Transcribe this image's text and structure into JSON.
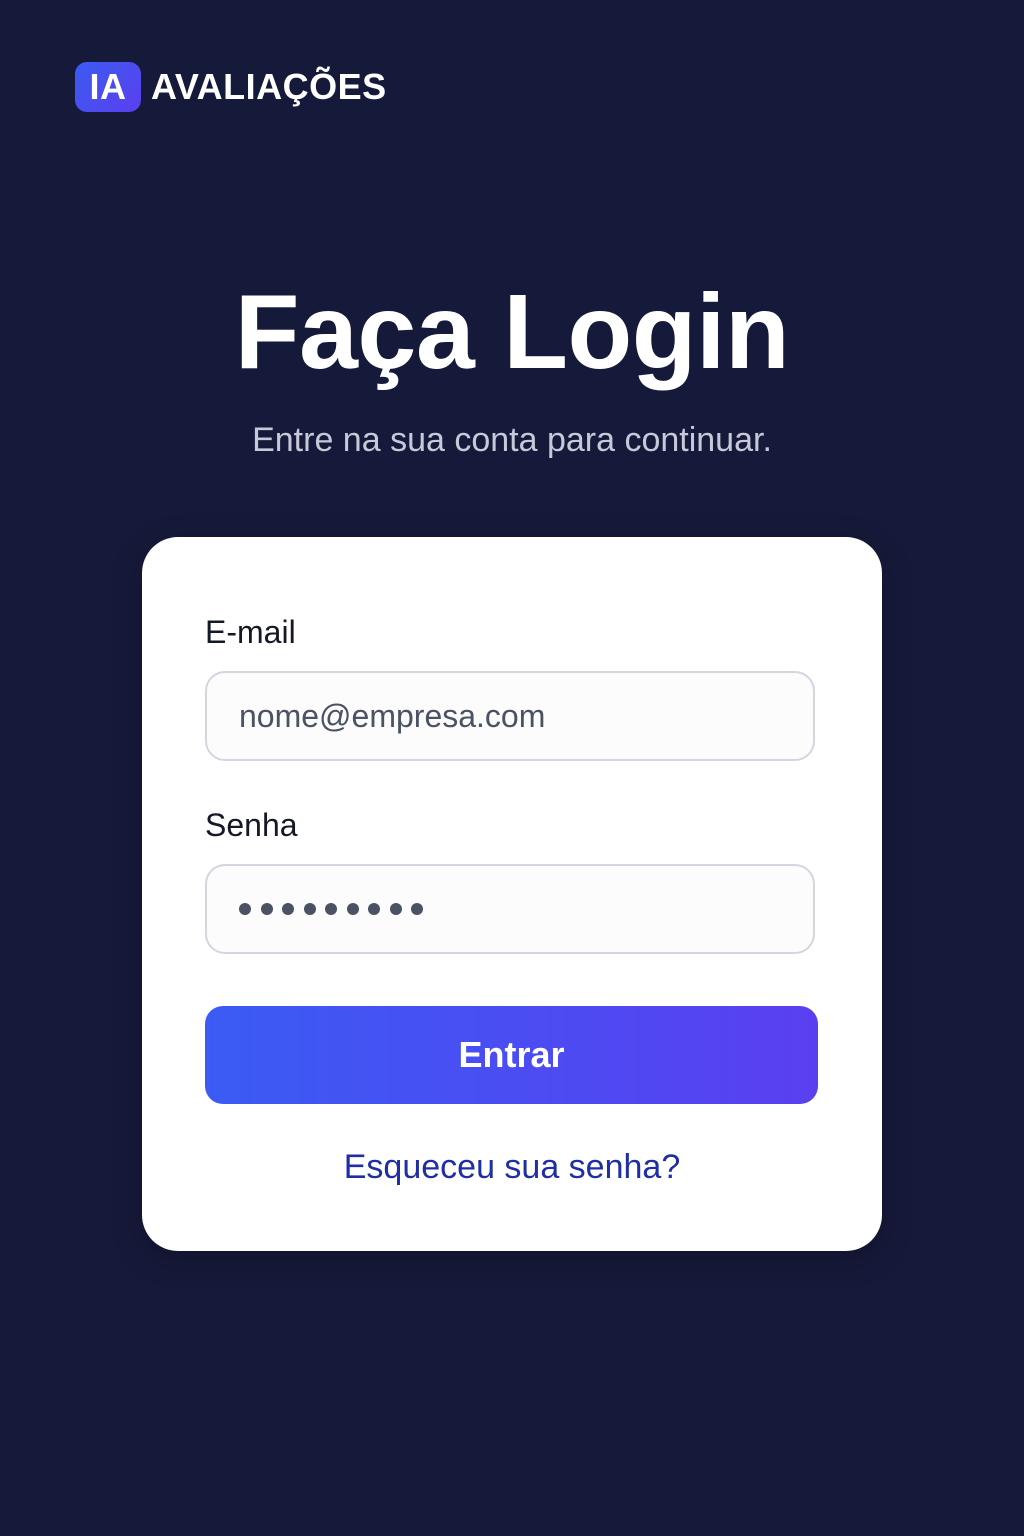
{
  "brand": {
    "badge": "IA",
    "name": "AVALIAÇÕES"
  },
  "header": {
    "title": "Faça Login",
    "subtitle": "Entre na sua conta para continuar."
  },
  "form": {
    "email_label": "E-mail",
    "email_value": "nome@empresa.com",
    "password_label": "Senha",
    "password_masked_length": 9,
    "submit_label": "Entrar",
    "forgot_label": "Esqueceu sua senha?"
  },
  "colors": {
    "background": "#161a3a",
    "card": "#ffffff",
    "accent_start": "#3b5bf4",
    "accent_end": "#5a3ff1",
    "link": "#1f2ea6"
  }
}
